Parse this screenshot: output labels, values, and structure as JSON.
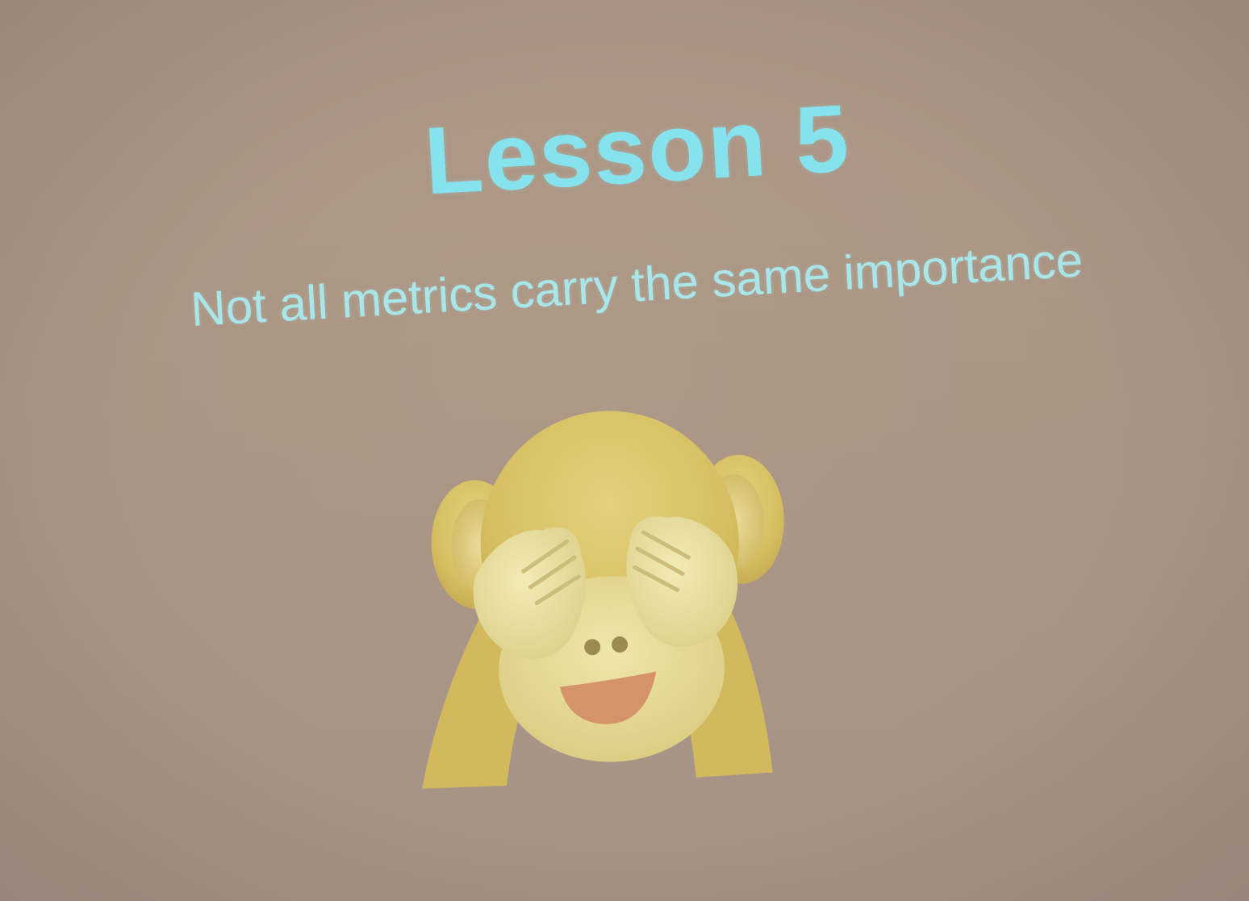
{
  "slide": {
    "title": "Lesson 5",
    "subtitle": "Not all metrics carry the same importance",
    "emoji_icon": "see-no-evil-monkey-icon"
  },
  "colors": {
    "background": "#ad9886",
    "title": "#86e3ee",
    "subtitle": "#a9e6ea",
    "monkey_fur": "#d9c36a",
    "monkey_face": "#e9dd95",
    "hands": "#eee2a0",
    "mouth": "#d6936a"
  }
}
